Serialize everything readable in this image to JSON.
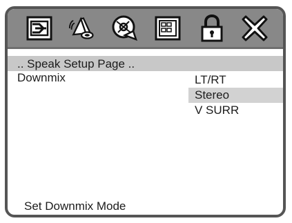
{
  "toolbar": {
    "icons": [
      {
        "name": "general-setup-icon"
      },
      {
        "name": "speaker-setup-icon"
      },
      {
        "name": "video-setup-icon"
      },
      {
        "name": "preference-setup-icon"
      },
      {
        "name": "password-lock-icon"
      },
      {
        "name": "exit-icon"
      }
    ]
  },
  "page": {
    "title": ".. Speak Setup Page .."
  },
  "setting": {
    "label": "Downmix",
    "options": [
      "LT/RT",
      "Stereo",
      "V SURR"
    ],
    "selected": "Stereo"
  },
  "status": {
    "text": "Set Downmix Mode"
  },
  "colors": {
    "icon_bar": "#888888",
    "frame_border": "#555555",
    "highlight": "#c8c8c8"
  }
}
